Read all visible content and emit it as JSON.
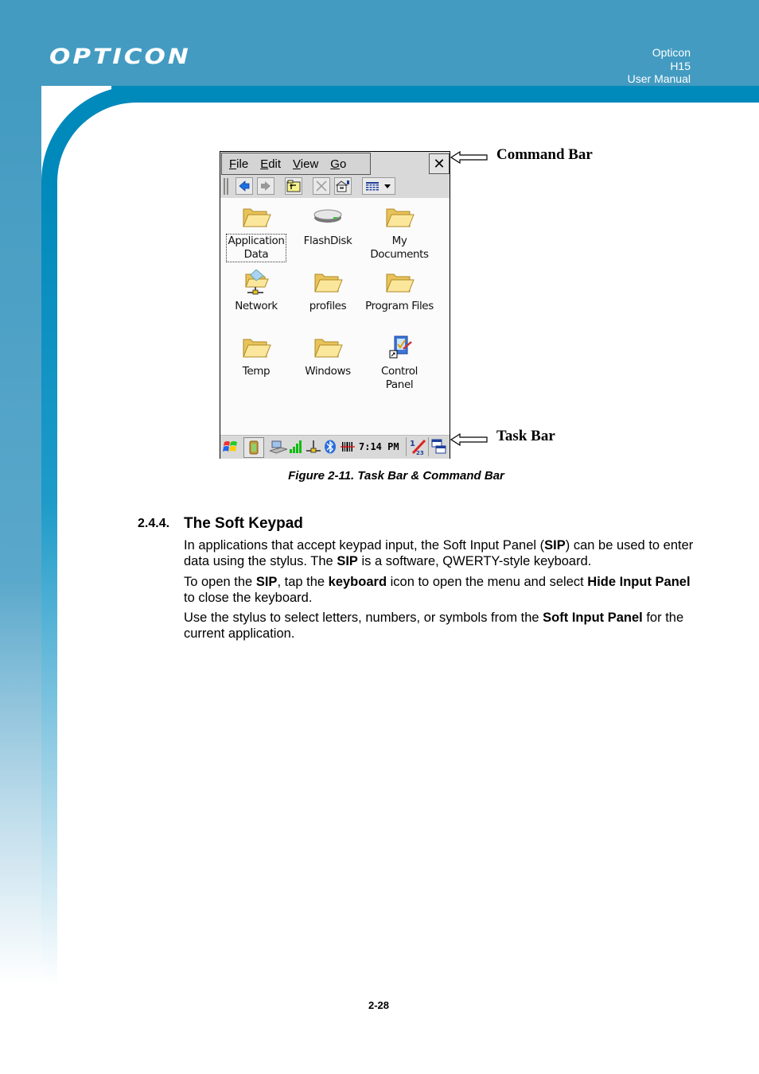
{
  "header": {
    "logo": "OPTICON",
    "right_lines": [
      "Opticon",
      "H15",
      "User Manual"
    ]
  },
  "colors": {
    "header_blue": "#439bc1",
    "stripe_blue": "#0089bb"
  },
  "figure": {
    "command_bar": {
      "menus": [
        {
          "label": "File",
          "underline": "F",
          "rest": "ile"
        },
        {
          "label": "Edit",
          "underline": "E",
          "rest": "dit"
        },
        {
          "label": "View",
          "underline": "V",
          "rest": "iew"
        },
        {
          "label": "Go",
          "underline": "G",
          "rest": "o"
        }
      ],
      "close_label": "✕",
      "toolbar_icons": [
        "back-icon",
        "forward-icon",
        "up-folder-icon",
        "delete-icon",
        "properties-icon",
        "view-menu-icon"
      ]
    },
    "items": [
      {
        "label_lines": [
          "Application",
          "Data"
        ],
        "icon": "folder-icon",
        "selected": true
      },
      {
        "label_lines": [
          "FlashDisk"
        ],
        "icon": "flashdisk-icon"
      },
      {
        "label_lines": [
          "My",
          "Documents"
        ],
        "icon": "folder-icon"
      },
      {
        "label_lines": [
          "Network"
        ],
        "icon": "network-folder-icon"
      },
      {
        "label_lines": [
          "profiles"
        ],
        "icon": "folder-icon"
      },
      {
        "label_lines": [
          "Program Files"
        ],
        "icon": "folder-icon"
      },
      {
        "label_lines": [
          "Temp"
        ],
        "icon": "folder-icon"
      },
      {
        "label_lines": [
          "Windows"
        ],
        "icon": "folder-icon"
      },
      {
        "label_lines": [
          "Control",
          "Panel"
        ],
        "icon": "control-panel-icon"
      }
    ],
    "task_bar": {
      "clock": "7:14 PM",
      "icons": [
        "start-icon",
        "battery-icon",
        "connection-icon",
        "signal-icon",
        "network-icon",
        "bluetooth-icon",
        "barcode-icon",
        "input-panel-icon",
        "switch-window-icon"
      ]
    },
    "callouts": {
      "command_bar": "Command Bar",
      "task_bar": "Task Bar"
    },
    "caption": "Figure 2-11. Task Bar & Command Bar"
  },
  "section": {
    "number": "2.4.4.",
    "title": "The Soft Keypad",
    "paragraphs": [
      [
        {
          "t": "In applications that accept keypad input, the Soft Input Panel ("
        },
        {
          "t": "SIP",
          "b": true
        },
        {
          "t": ") can be used to enter data using the stylus. The "
        },
        {
          "t": "SIP",
          "b": true
        },
        {
          "t": " is a software, QWERTY-style keyboard."
        }
      ],
      [
        {
          "t": "To open the "
        },
        {
          "t": "SIP",
          "b": true
        },
        {
          "t": ", tap the "
        },
        {
          "t": "keyboard",
          "b": true
        },
        {
          "t": " icon to open the menu and select "
        },
        {
          "t": "Hide Input Panel",
          "b": true
        },
        {
          "t": " to close the keyboard."
        }
      ],
      [
        {
          "t": "Use the stylus to select letters, numbers, or symbols from the "
        },
        {
          "t": "Soft Input Panel",
          "b": true
        },
        {
          "t": " for the current application."
        }
      ]
    ]
  },
  "footer": {
    "page_number": "2-28"
  }
}
